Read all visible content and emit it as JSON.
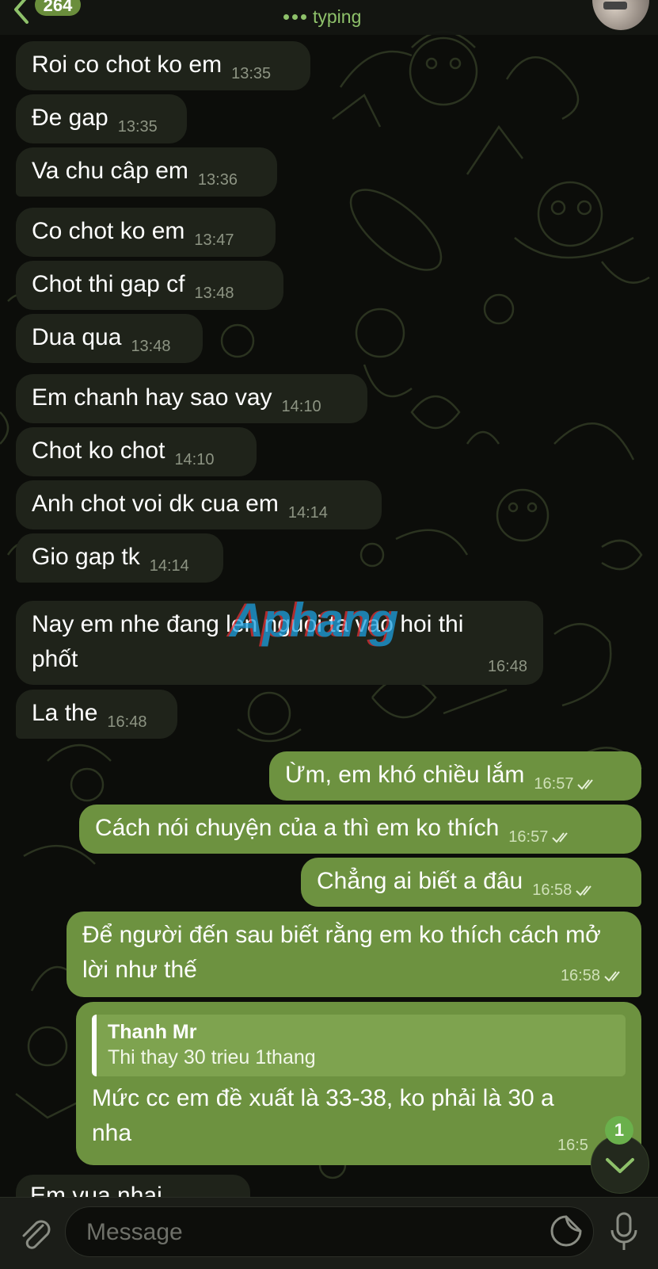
{
  "header": {
    "unread_count": "264",
    "status": "typing"
  },
  "messages": [
    {
      "direction": "in",
      "text": "Roi co chot ko em",
      "time": "13:35"
    },
    {
      "direction": "in",
      "text": "Đe gap",
      "time": "13:35"
    },
    {
      "direction": "in",
      "text": "Va chu câp em",
      "time": "13:36"
    },
    {
      "direction": "in",
      "text": "Co chot ko em",
      "time": "13:47"
    },
    {
      "direction": "in",
      "text": "Chot thi gap cf",
      "time": "13:48"
    },
    {
      "direction": "in",
      "text": "Dua qua",
      "time": "13:48"
    },
    {
      "direction": "in",
      "text": "Em chanh hay sao vay",
      "time": "14:10"
    },
    {
      "direction": "in",
      "text": "Chot ko chot",
      "time": "14:10"
    },
    {
      "direction": "in",
      "text": "Anh chot voi dk cua em",
      "time": "14:14"
    },
    {
      "direction": "in",
      "text": "Gio gap tk",
      "time": "14:14"
    },
    {
      "direction": "in",
      "text": "Nay em nhe đang len nguoi ta vao hoi thi phốt",
      "time": "16:48"
    },
    {
      "direction": "in",
      "text": "La the",
      "time": "16:48"
    },
    {
      "direction": "out",
      "text": "Ừm, em khó chiều lắm",
      "time": "16:57"
    },
    {
      "direction": "out",
      "text": "Cách nói chuyện của a thì em ko thích",
      "time": "16:57"
    },
    {
      "direction": "out",
      "text": "Chẳng ai biết a đâu",
      "time": "16:58"
    },
    {
      "direction": "out",
      "text": "Để người đến sau biết rằng em ko thích cách mở lời như thế",
      "time": "16:58"
    },
    {
      "direction": "out",
      "text": "Mức cc em đề xuất là 33-38, ko phải là 30 a nha",
      "time": "16:5",
      "reply": {
        "name": "Thanh Mr",
        "text": "Thi thay 30 trieu 1thang"
      }
    },
    {
      "direction": "in",
      "text": "Em vua nhai",
      "time": ""
    }
  ],
  "watermark": "Aphang",
  "scroll_down_badge": "1",
  "composer": {
    "placeholder": "Message"
  },
  "colors": {
    "incoming": "#1f231a",
    "outgoing": "#6d9240",
    "accent": "#8ec16a"
  }
}
